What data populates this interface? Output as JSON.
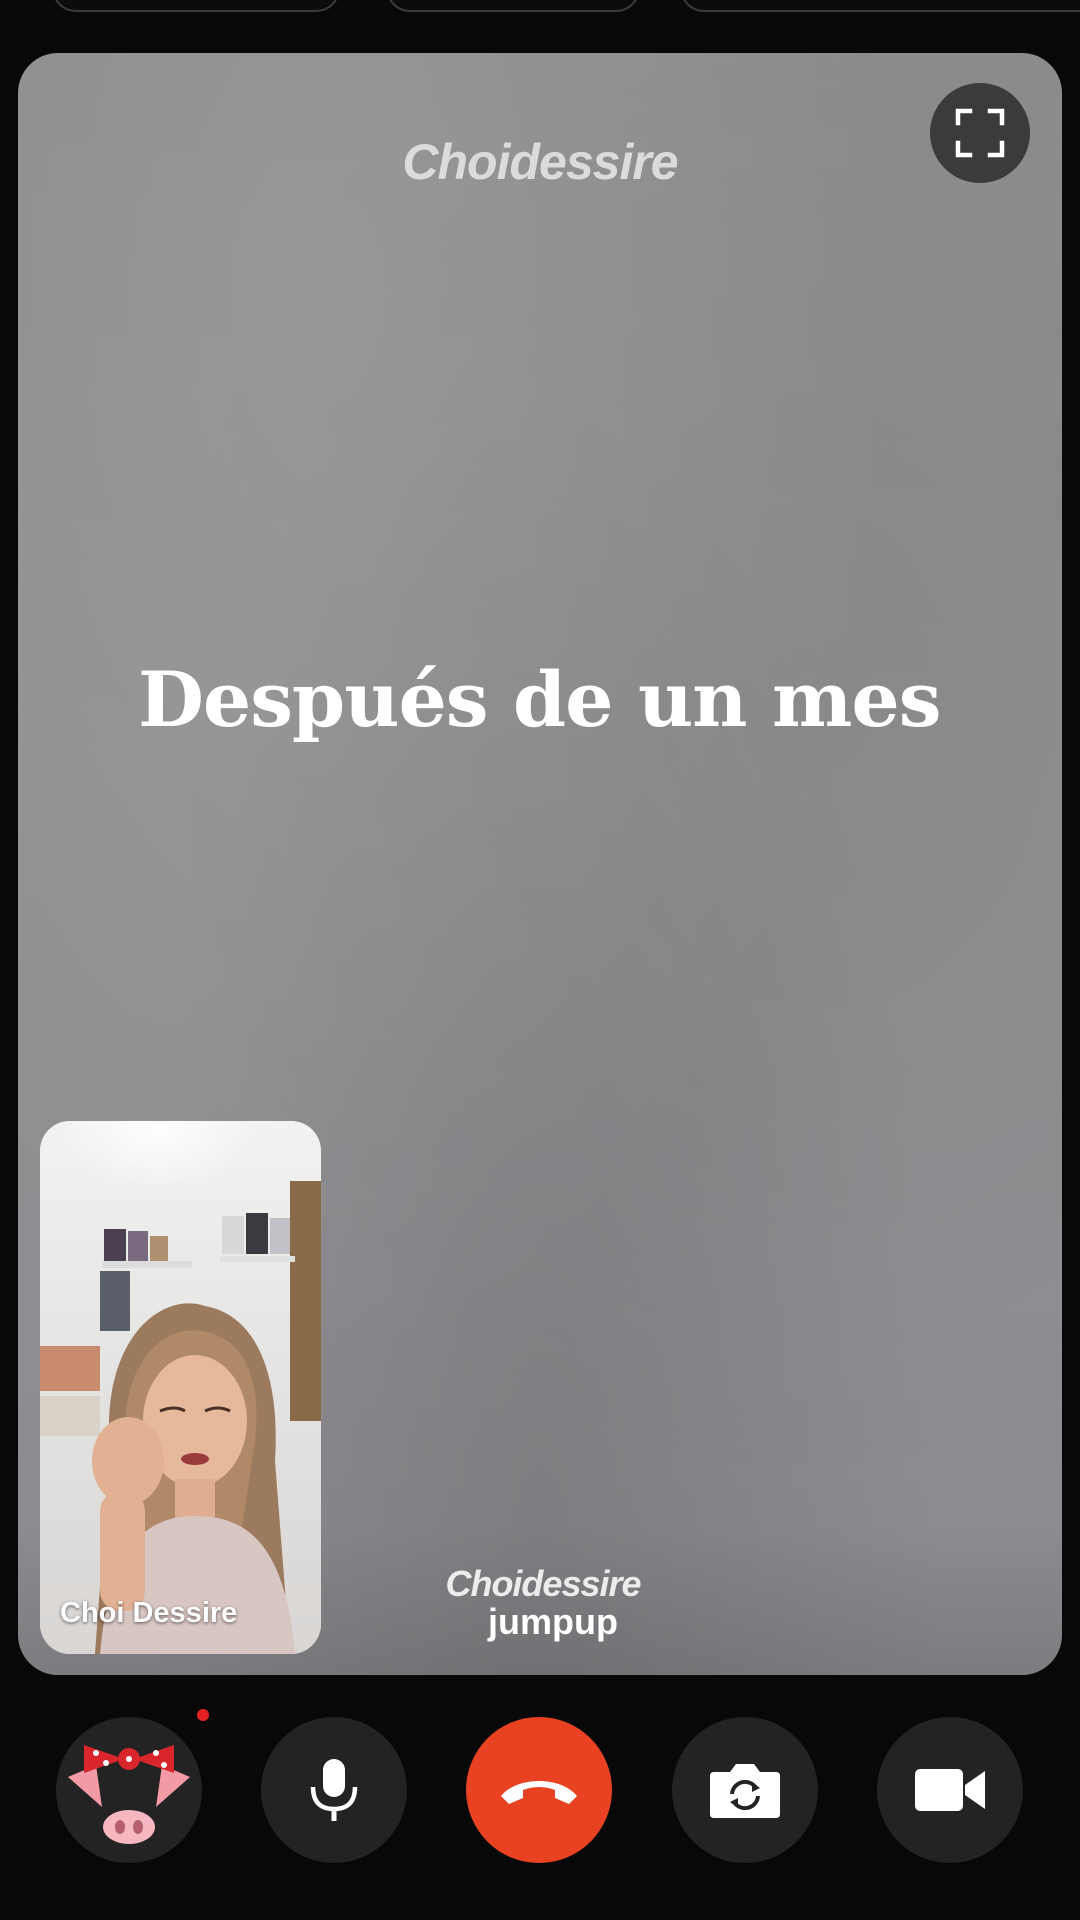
{
  "call": {
    "watermark_top": "Choidessire",
    "caption": "Después de un mes",
    "watermark_bottom": "Choidessire",
    "remote_label": "jumpup"
  },
  "self_view": {
    "name": "Choi Dessire"
  },
  "controls": {
    "effects_icon": "pig-face-icon",
    "mic_icon": "microphone-icon",
    "end_icon": "end-call-icon",
    "flip_icon": "camera-flip-icon",
    "video_icon": "video-camera-icon"
  },
  "colors": {
    "end_call": "#e84222",
    "control_bg": "#232323",
    "notification_dot": "#e52222"
  }
}
